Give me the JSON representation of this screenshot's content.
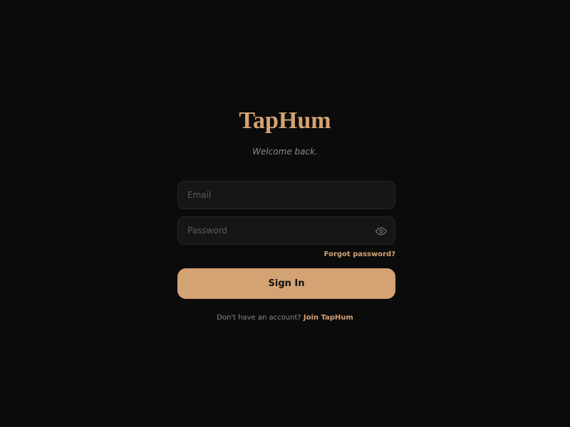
{
  "brand": {
    "name": "TapHum",
    "tagline": "Welcome back."
  },
  "form": {
    "email": {
      "placeholder": "Email",
      "value": ""
    },
    "password": {
      "placeholder": "Password",
      "value": "",
      "toggle_icon": "eye-icon"
    },
    "forgot_password_label": "Forgot password?",
    "submit_label": "Sign In"
  },
  "footer": {
    "prompt": "Don't have an account?",
    "join_label": "Join TapHum"
  },
  "colors": {
    "background": "#0b0b0b",
    "accent": "#d4a373",
    "field_background": "#161616",
    "muted_text": "#8a8a8a"
  }
}
